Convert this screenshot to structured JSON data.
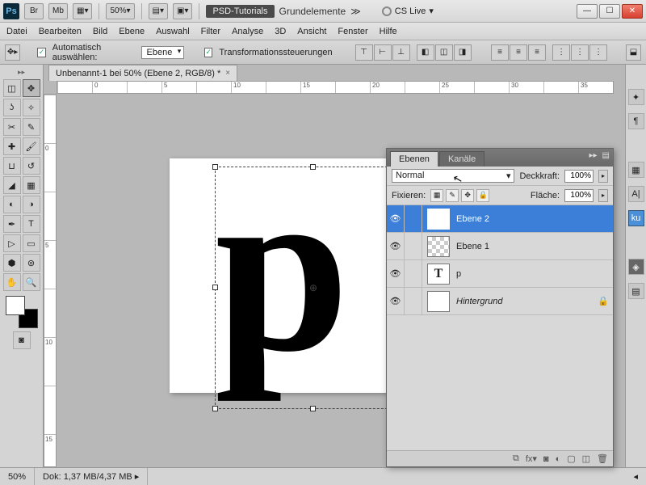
{
  "titlebar": {
    "apps": [
      "Br",
      "Mb"
    ],
    "zoom": "50%",
    "badge": "PSD-Tutorials",
    "workspace": "Grundelemente",
    "cslive": "CS Live"
  },
  "menu": [
    "Datei",
    "Bearbeiten",
    "Bild",
    "Ebene",
    "Auswahl",
    "Filter",
    "Analyse",
    "3D",
    "Ansicht",
    "Fenster",
    "Hilfe"
  ],
  "options": {
    "autoSelect": "Automatisch auswählen:",
    "autoSelectMode": "Ebene",
    "transform": "Transformationssteuerungen"
  },
  "docTab": "Unbenannt-1 bei 50% (Ebene 2, RGB/8) *",
  "rulerH": [
    "",
    "0",
    "",
    "5",
    "",
    "10",
    "",
    "15",
    "",
    "20",
    "",
    "25",
    "",
    "30",
    "",
    "35"
  ],
  "rulerV": [
    "",
    "0",
    "",
    "5",
    "",
    "10",
    "",
    "15"
  ],
  "panel": {
    "tabs": [
      "Ebenen",
      "Kanäle"
    ],
    "blend": "Normal",
    "opacityLabel": "Deckkraft:",
    "opacity": "100%",
    "lockLabel": "Fixieren:",
    "fillLabel": "Fläche:",
    "fill": "100%",
    "layers": [
      {
        "name": "Ebene 2",
        "sel": true,
        "thumb": "p"
      },
      {
        "name": "Ebene 1",
        "thumb": "checker"
      },
      {
        "name": "p",
        "thumb": "T"
      },
      {
        "name": "Hintergrund",
        "thumb": "blank",
        "lock": true,
        "italic": true
      }
    ]
  },
  "status": {
    "zoom": "50%",
    "doc": "Dok: 1,37 MB/4,37 MB"
  }
}
